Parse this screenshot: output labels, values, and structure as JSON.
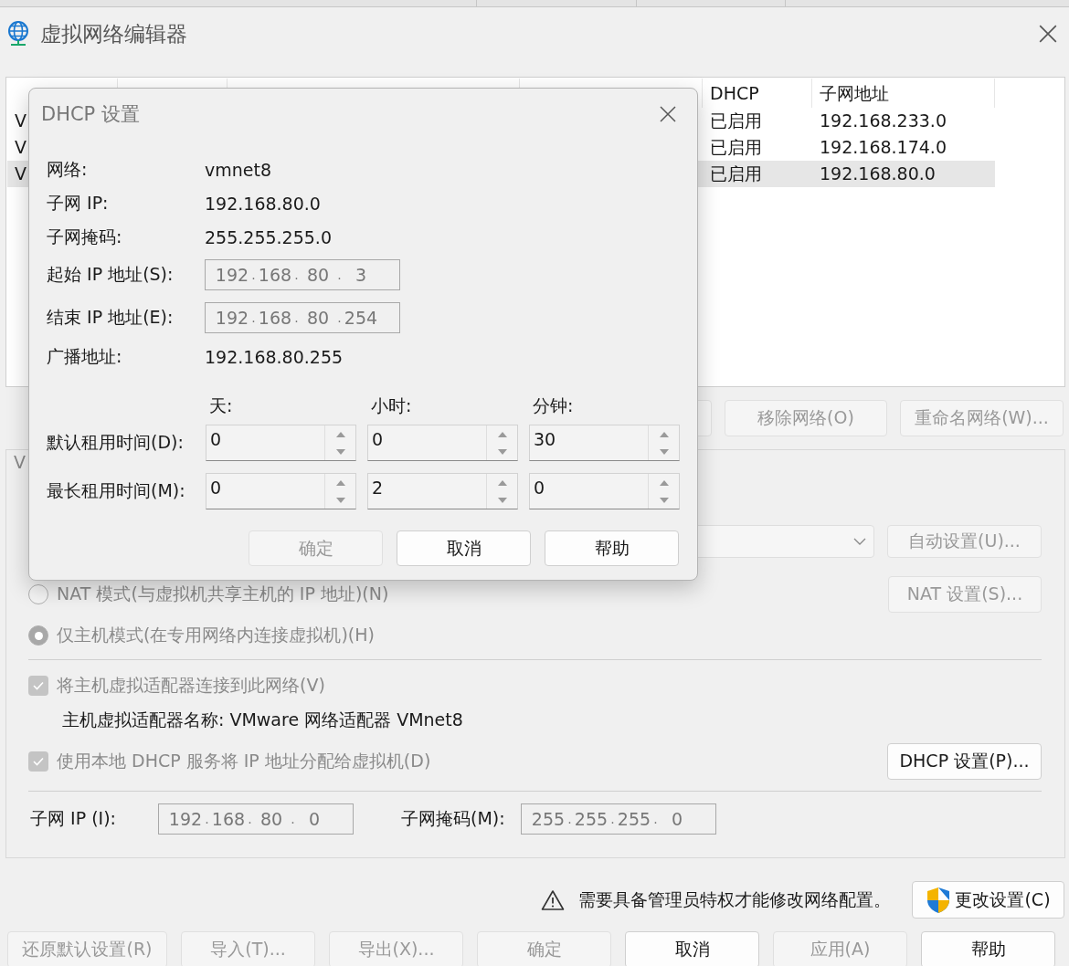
{
  "window": {
    "title": "虚拟网络编辑器"
  },
  "table": {
    "columns": [
      "DHCP",
      "子网地址"
    ],
    "rows": [
      {
        "name": "V",
        "dhcp": "已启用",
        "subnet": "192.168.233.0",
        "selected": false
      },
      {
        "name": "V",
        "dhcp": "已启用",
        "subnet": "192.168.174.0",
        "selected": false
      },
      {
        "name": "V",
        "dhcp": "已启用",
        "subnet": "192.168.80.0",
        "selected": true
      }
    ]
  },
  "network_buttons": [
    {
      "label": "移除网络(O)",
      "disabled": true
    },
    {
      "label": "重命名网络(W)...",
      "disabled": true
    }
  ],
  "group": {
    "label": "V",
    "auto_button": {
      "label": "自动设置(U)...",
      "disabled": true
    },
    "nat_button": {
      "label": "NAT 设置(S)...",
      "disabled": true
    },
    "modes": [
      {
        "label": "NAT 模式(与虚拟机共享主机的 IP 地址)(N)",
        "selected": false,
        "disabled": true
      },
      {
        "label": "仅主机模式(在专用网络内连接虚拟机)(H)",
        "selected": true,
        "disabled": true
      }
    ],
    "connect_adapter": {
      "label": "将主机虚拟适配器连接到此网络(V)",
      "checked": true,
      "disabled": true
    },
    "adapter_name": "主机虚拟适配器名称: VMware 网络适配器 VMnet8",
    "use_dhcp": {
      "label": "使用本地 DHCP 服务将 IP 地址分配给虚拟机(D)",
      "checked": true,
      "disabled": true
    },
    "dhcp_button": {
      "label": "DHCP 设置(P)...",
      "disabled": false
    },
    "subnet_ip": {
      "label": "子网 IP (I):",
      "octets": [
        "192",
        "168",
        "80",
        "0"
      ],
      "separator": "."
    },
    "subnet_mask": {
      "label": "子网掩码(M):",
      "octets": [
        "255",
        "255",
        "255",
        "0"
      ],
      "separator": "."
    }
  },
  "warning": {
    "text": "需要具备管理员特权才能修改网络配置。",
    "button": {
      "label": "更改设置(C)",
      "disabled": false
    }
  },
  "footer_buttons": [
    {
      "label": "还原默认设置(R)",
      "disabled": true
    },
    {
      "label": "导入(T)...",
      "disabled": true
    },
    {
      "label": "导出(X)...",
      "disabled": true
    },
    {
      "label": "确定",
      "disabled": true
    },
    {
      "label": "取消",
      "disabled": false
    },
    {
      "label": "应用(A)",
      "disabled": true
    },
    {
      "label": "帮助",
      "disabled": false
    }
  ],
  "dialog": {
    "title": "DHCP 设置",
    "info": [
      {
        "label": "网络:",
        "value": "vmnet8"
      },
      {
        "label": "子网 IP:",
        "value": "192.168.80.0"
      },
      {
        "label": "子网掩码:",
        "value": "255.255.255.0"
      }
    ],
    "ranges": [
      {
        "label": "起始 IP 地址(S):",
        "octets": [
          "192",
          "168",
          "80",
          "3"
        ],
        "separator": "."
      },
      {
        "label": "结束 IP 地址(E):",
        "octets": [
          "192",
          "168",
          "80",
          "254"
        ],
        "separator": "."
      }
    ],
    "broadcast": {
      "label": "广播地址:",
      "value": "192.168.80.255"
    },
    "lease_units": [
      "天:",
      "小时:",
      "分钟:"
    ],
    "leases": [
      {
        "label": "默认租用时间(D):",
        "values": [
          "0",
          "0",
          "30"
        ]
      },
      {
        "label": "最长租用时间(M):",
        "values": [
          "0",
          "2",
          "0"
        ]
      }
    ],
    "buttons": [
      {
        "label": "确定",
        "disabled": true
      },
      {
        "label": "取消",
        "disabled": false
      },
      {
        "label": "帮助",
        "disabled": false
      }
    ]
  }
}
